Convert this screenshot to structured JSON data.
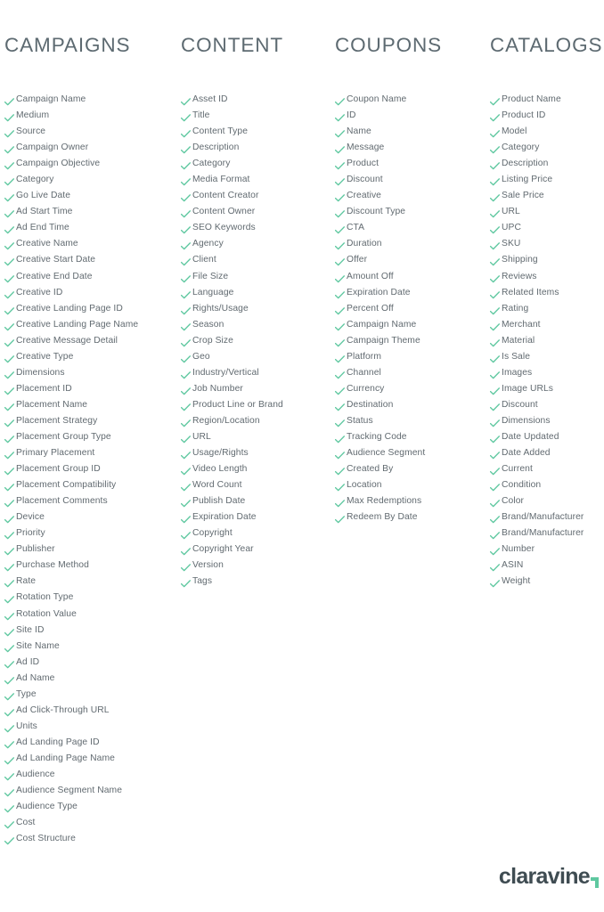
{
  "page": {
    "background_color": "#ffffff",
    "check_color": "#5fc8a0",
    "text_color": "#616a70",
    "heading_color": "#5d6a71",
    "check_icon": "check-icon"
  },
  "columns": [
    {
      "title": "CAMPAIGNS",
      "items": [
        "Campaign Name",
        "Medium",
        "Source",
        "Campaign Owner",
        "Campaign Objective",
        "Category",
        "Go Live Date",
        "Ad Start Time",
        "Ad End Time",
        "Creative Name",
        "Creative Start Date",
        "Creative End Date",
        "Creative ID",
        "Creative Landing Page ID",
        "Creative Landing Page Name",
        "Creative Message Detail",
        "Creative Type",
        "Dimensions",
        "Placement ID",
        "Placement Name",
        "Placement Strategy",
        "Placement Group Type",
        "Primary Placement",
        "Placement Group ID",
        "Placement Compatibility",
        "Placement Comments",
        "Device",
        "Priority",
        "Publisher",
        "Purchase Method",
        "Rate",
        "Rotation Type",
        "Rotation Value",
        "Site ID",
        "Site Name",
        "Ad ID",
        "Ad Name",
        "Type",
        "Ad Click-Through URL",
        "Units",
        "Ad Landing Page ID",
        "Ad Landing Page Name",
        "Audience",
        "Audience Segment Name",
        "Audience Type",
        "Cost",
        "Cost Structure"
      ]
    },
    {
      "title": "CONTENT",
      "items": [
        "Asset ID",
        "Title",
        "Content Type",
        "Description",
        "Category",
        "Media Format",
        "Content Creator",
        "Content Owner",
        "SEO Keywords",
        "Agency",
        "Client",
        "File Size",
        "Language",
        "Rights/Usage",
        "Season",
        "Crop Size",
        "Geo",
        "Industry/Vertical",
        "Job Number",
        "Product Line or Brand",
        "Region/Location",
        "URL",
        "Usage/Rights",
        "Video Length",
        "Word Count",
        "Publish Date",
        "Expiration Date",
        "Copyright",
        "Copyright Year",
        "Version",
        "Tags"
      ]
    },
    {
      "title": "COUPONS",
      "items": [
        "Coupon Name",
        "ID",
        "Name",
        "Message",
        "Product",
        "Discount",
        "Creative",
        "Discount Type",
        "CTA",
        "Duration",
        "Offer",
        "Amount Off",
        "Expiration Date",
        "Percent Off",
        "Campaign Name",
        "Campaign Theme",
        "Platform",
        "Channel",
        "Currency",
        "Destination",
        "Status",
        "Tracking Code",
        "Audience Segment",
        "Created By",
        "Location",
        "Max Redemptions",
        "Redeem By Date"
      ]
    },
    {
      "title": "CATALOGS",
      "items": [
        "Product Name",
        "Product ID",
        "Model",
        "Category",
        "Description",
        "Listing Price",
        "Sale Price",
        "URL",
        "UPC",
        "SKU",
        "Shipping",
        "Reviews",
        "Related Items",
        "Rating",
        "Merchant",
        "Material",
        "Is Sale",
        "Images",
        "Image URLs",
        "Discount",
        "Dimensions",
        "Date Updated",
        "Date Added",
        "Current",
        "Condition",
        "Color",
        "Brand/Manufacturer",
        "Brand/Manufacturer",
        "Number",
        "ASIN",
        "Weight"
      ]
    }
  ],
  "logo": {
    "wordmark": "claravine",
    "mark_color": "#5fc8a0",
    "word_color": "#3f4c52"
  }
}
